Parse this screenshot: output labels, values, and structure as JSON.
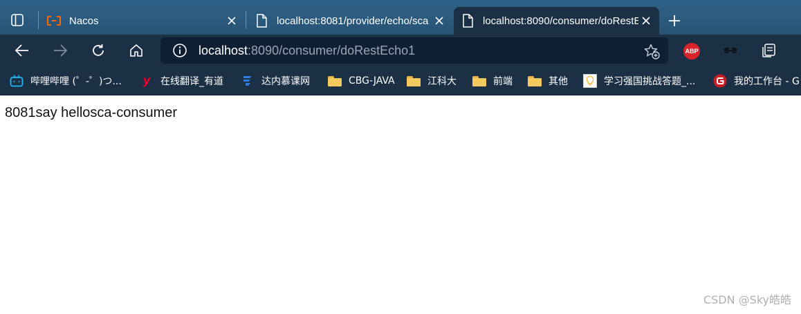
{
  "tabs": [
    {
      "label": "Nacos",
      "icon": "alibaba-cloud-icon"
    },
    {
      "label": "localhost:8081/provider/echo/sca",
      "icon": "page-icon"
    },
    {
      "label": "localhost:8090/consumer/doRestEcho1",
      "icon": "page-icon",
      "active": true
    }
  ],
  "address": {
    "host": "localhost",
    "path": ":8090/consumer/doRestEcho1"
  },
  "extensions": {
    "abp_label": "ABP"
  },
  "bookmarks": [
    {
      "label": "哔哩哔哩 (゜-゜)つ...",
      "icon": "bilibili-icon"
    },
    {
      "label": "在线翻译_有道",
      "icon": "youdao-icon"
    },
    {
      "label": "达内慕课网",
      "icon": "tarena-icon"
    },
    {
      "label": "CBG-JAVA",
      "icon": "folder-icon"
    },
    {
      "label": "江科大",
      "icon": "folder-icon"
    },
    {
      "label": "前端",
      "icon": "folder-icon"
    },
    {
      "label": "其他",
      "icon": "folder-icon"
    },
    {
      "label": "学习强国挑战答题_...",
      "icon": "lightbulb-icon"
    },
    {
      "label": "我的工作台 - G",
      "icon": "gitee-icon"
    }
  ],
  "page": {
    "text": "8081say hellosca-consumer"
  },
  "watermark": "CSDN @Sky皓皓",
  "colors": {
    "tabstrip": "#2b5a7e",
    "toolbar": "#1b2f45",
    "address_bg": "#0f1f33",
    "abp_red": "#d8232a",
    "youdao_red": "#e4002b",
    "gitee_red": "#c71d23",
    "bilibili_blue": "#23ade5"
  }
}
